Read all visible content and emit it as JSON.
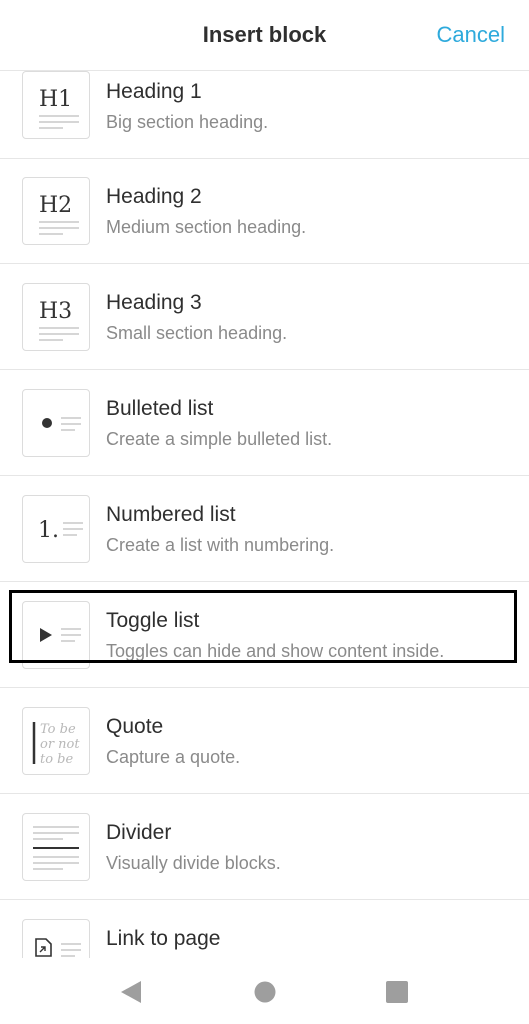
{
  "header": {
    "title": "Insert block",
    "cancel_label": "Cancel"
  },
  "blocks": [
    {
      "title": "Heading 1",
      "description": "Big section heading.",
      "glyph": "H1",
      "icon": "heading-1-icon"
    },
    {
      "title": "Heading 2",
      "description": "Medium section heading.",
      "glyph": "H2",
      "icon": "heading-2-icon"
    },
    {
      "title": "Heading 3",
      "description": "Small section heading.",
      "glyph": "H3",
      "icon": "heading-3-icon"
    },
    {
      "title": "Bulleted list",
      "description": "Create a simple bulleted list.",
      "icon": "bulleted-list-icon"
    },
    {
      "title": "Numbered list",
      "description": "Create a list with numbering.",
      "glyph": "1.",
      "icon": "numbered-list-icon"
    },
    {
      "title": "Toggle list",
      "description": "Toggles can hide and show content inside.",
      "icon": "toggle-list-icon"
    },
    {
      "title": "Quote",
      "description": "Capture a quote.",
      "quote_lines": [
        "To be",
        "or not",
        "to be"
      ],
      "icon": "quote-icon"
    },
    {
      "title": "Divider",
      "description": "Visually divide blocks.",
      "icon": "divider-icon"
    },
    {
      "title": "Link to page",
      "description": "",
      "icon": "link-to-page-icon"
    }
  ],
  "colors": {
    "accent": "#2eaadc",
    "text": "#2f2f2f",
    "muted": "#8a8a8a",
    "border": "#e6e6e6",
    "nav_icon": "#9e9e9e"
  },
  "navbar": {
    "icons": [
      "back-icon",
      "home-icon",
      "recents-icon"
    ]
  }
}
